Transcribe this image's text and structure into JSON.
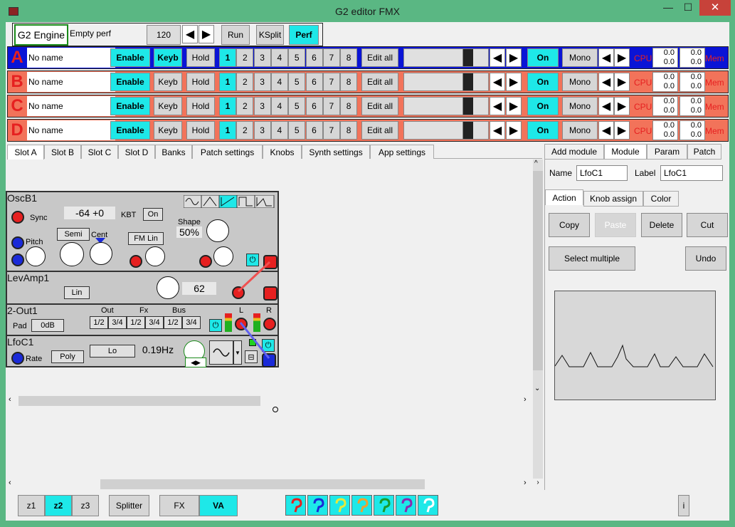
{
  "window": {
    "title": "G2 editor FMX",
    "minimize": "—",
    "maximize": "☐",
    "close": "✕"
  },
  "topbar": {
    "engine": "G2 Engine",
    "perf_name": "Empty perf",
    "tempo": "120",
    "run": "Run",
    "ksplit": "KSplit",
    "perf": "Perf"
  },
  "slots": [
    {
      "letter": "A",
      "name": "No name",
      "enable": "Enable",
      "keyb": "Keyb",
      "hold": "Hold",
      "variations": [
        "1",
        "2",
        "3",
        "4",
        "5",
        "6",
        "7",
        "8"
      ],
      "edit_all": "Edit all",
      "on": "On",
      "mono": "Mono",
      "cpu": "CPU",
      "cpu_vals": [
        "0.0",
        "0.0",
        "0.0",
        "0.0"
      ],
      "mem": "Mem",
      "color": "#0a14d6"
    },
    {
      "letter": "B",
      "name": "No name",
      "enable": "Enable",
      "keyb": "Keyb",
      "hold": "Hold",
      "variations": [
        "1",
        "2",
        "3",
        "4",
        "5",
        "6",
        "7",
        "8"
      ],
      "edit_all": "Edit all",
      "on": "On",
      "mono": "Mono",
      "cpu": "CPU",
      "cpu_vals": [
        "0.0",
        "0.0",
        "0.0",
        "0.0"
      ],
      "mem": "Mem",
      "color": "#f2735a"
    },
    {
      "letter": "C",
      "name": "No name",
      "enable": "Enable",
      "keyb": "Keyb",
      "hold": "Hold",
      "variations": [
        "1",
        "2",
        "3",
        "4",
        "5",
        "6",
        "7",
        "8"
      ],
      "edit_all": "Edit all",
      "on": "On",
      "mono": "Mono",
      "cpu": "CPU",
      "cpu_vals": [
        "0.0",
        "0.0",
        "0.0",
        "0.0"
      ],
      "mem": "Mem",
      "color": "#f2735a"
    },
    {
      "letter": "D",
      "name": "No name",
      "enable": "Enable",
      "keyb": "Keyb",
      "hold": "Hold",
      "variations": [
        "1",
        "2",
        "3",
        "4",
        "5",
        "6",
        "7",
        "8"
      ],
      "edit_all": "Edit all",
      "on": "On",
      "mono": "Mono",
      "cpu": "CPU",
      "cpu_vals": [
        "0.0",
        "0.0",
        "0.0",
        "0.0"
      ],
      "mem": "Mem",
      "color": "#f2735a"
    }
  ],
  "tabs": [
    "Slot A",
    "Slot B",
    "Slot C",
    "Slot D",
    "Banks",
    "Patch settings",
    "Knobs",
    "Synth settings",
    "App settings"
  ],
  "modules": {
    "osc": {
      "title": "OscB1",
      "sync": "Sync",
      "value": "-64  +0",
      "kbt": "KBT",
      "kbt_on": "On",
      "semi": "Semi",
      "cent": "Cent",
      "pitch": "Pitch",
      "fmlin": "FM Lin",
      "shape": "Shape",
      "shape_val": "50%"
    },
    "levamp": {
      "title": "LevAmp1",
      "lin": "Lin",
      "value": "62"
    },
    "out": {
      "title": "2-Out1",
      "pad": "Pad",
      "pad_val": "0dB",
      "out": "Out",
      "fx": "Fx",
      "bus": "Bus",
      "l": "L",
      "r": "R",
      "groups": [
        "1/2",
        "3/4",
        "1/2",
        "3/4",
        "1/2",
        "3/4"
      ]
    },
    "lfo": {
      "title": "LfoC1",
      "rate": "Rate",
      "poly": "Poly",
      "lo": "Lo",
      "freq": "0.19Hz"
    }
  },
  "right_panel": {
    "tabs": [
      "Add module",
      "Module",
      "Param",
      "Patch"
    ],
    "name_label": "Name",
    "name_val": "LfoC1",
    "label_label": "Label",
    "label_val": "LfoC1",
    "subtabs": [
      "Action",
      "Knob assign",
      "Color"
    ],
    "copy": "Copy",
    "paste": "Paste",
    "delete": "Delete",
    "cut": "Cut",
    "select_multiple": "Select multiple",
    "undo": "Undo"
  },
  "bottom": {
    "z1": "z1",
    "z2": "z2",
    "z3": "z3",
    "splitter": "Splitter",
    "fx": "FX",
    "va": "VA",
    "info": "i"
  },
  "cable_colors": [
    "#e62020",
    "#1a2ad8",
    "#e8e83a",
    "#f0a030",
    "#1a9a2a",
    "#8a2ab0",
    "#ffffff"
  ]
}
